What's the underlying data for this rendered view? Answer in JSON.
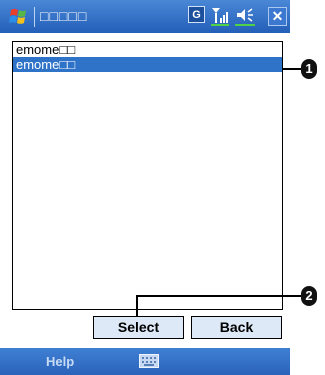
{
  "titlebar": {
    "title": "□□□□□",
    "status": {
      "g_label": "G",
      "close_glyph": "✕"
    },
    "icons": [
      "windows-flag-icon",
      "g-icon",
      "signal-icon",
      "speaker-icon",
      "close-icon"
    ]
  },
  "list": {
    "items": [
      {
        "label": "emome□□",
        "selected": false
      },
      {
        "label": "emome□□",
        "selected": true
      }
    ]
  },
  "callouts": {
    "one": "1",
    "two": "2"
  },
  "buttons": {
    "select": "Select",
    "back": "Back"
  },
  "menubar": {
    "help": "Help"
  },
  "colors": {
    "accent": "#2f73c9",
    "button_bg": "#dde9f7"
  }
}
